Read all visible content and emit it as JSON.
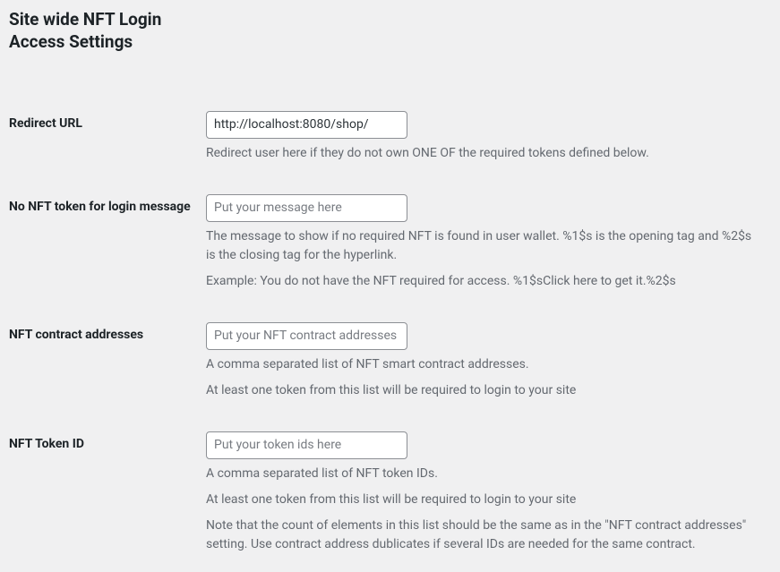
{
  "section_title": "Site wide NFT Login Access Settings",
  "fields": {
    "redirect_url": {
      "label": "Redirect URL",
      "value": "http://localhost:8080/shop/",
      "placeholder": "",
      "desc1": "Redirect user here if they do not own ONE OF the required tokens defined below."
    },
    "no_nft_message": {
      "label": "No NFT token for login message",
      "value": "",
      "placeholder": "Put your message here",
      "desc1": "The message to show if no required NFT is found in user wallet. %1$s is the opening tag and %2$s is the closing tag for the hyperlink.",
      "desc2": "Example: You do not have the NFT required for access. %1$sClick here to get it.%2$s"
    },
    "contract_addresses": {
      "label": "NFT contract addresses",
      "value": "",
      "placeholder": "Put your NFT contract addresses here",
      "desc1": "A comma separated list of NFT smart contract addresses.",
      "desc2": "At least one token from this list will be required to login to your site"
    },
    "token_id": {
      "label": "NFT Token ID",
      "value": "",
      "placeholder": "Put your token ids here",
      "desc1": "A comma separated list of NFT token IDs.",
      "desc2": "At least one token from this list will be required to login to your site",
      "desc3": "Note that the count of elements in this list should be the same as in the \"NFT contract addresses\" setting. Use contract address dublicates if several IDs are needed for the same contract."
    }
  }
}
